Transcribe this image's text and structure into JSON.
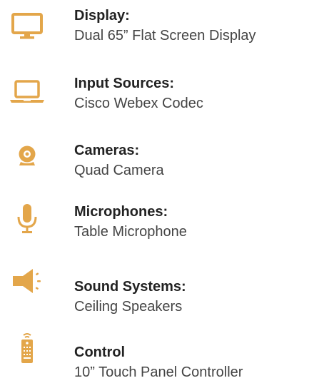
{
  "colors": {
    "icon_gold": "#E3A64A",
    "label_text": "#222222",
    "value_text": "#444444"
  },
  "specs": [
    {
      "icon": "monitor-icon",
      "label": "Display:",
      "value": "Dual 65” Flat Screen Display"
    },
    {
      "icon": "laptop-icon",
      "label": "Input Sources:",
      "value": "Cisco Webex Codec"
    },
    {
      "icon": "webcam-icon",
      "label": "Cameras:",
      "value": "Quad Camera"
    },
    {
      "icon": "microphone-icon",
      "label": "Microphones:",
      "value": "Table Microphone"
    },
    {
      "icon": "speaker-icon",
      "label": "Sound Systems:",
      "value": "Ceiling Speakers"
    },
    {
      "icon": "remote-control-icon",
      "label": "Control",
      "value": "10” Touch Panel Controller"
    }
  ]
}
